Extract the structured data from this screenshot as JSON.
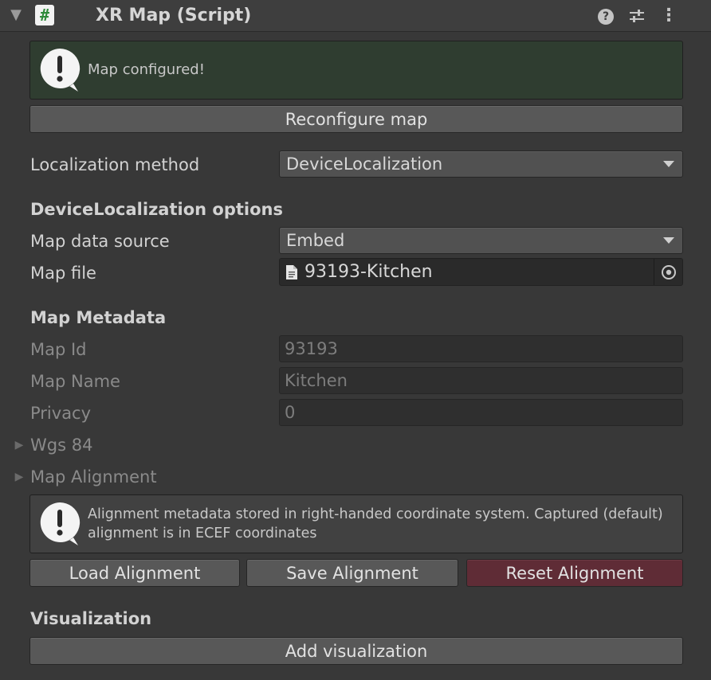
{
  "header": {
    "title": "XR Map (Script)",
    "icons": [
      "foldout-arrow-icon",
      "script-hash-icon",
      "help-icon",
      "preset-sliders-icon",
      "more-vertical-icon"
    ],
    "script_icon_glyph": "#"
  },
  "status_helpbox": {
    "message": "Map configured!",
    "icon": "info-balloon-icon",
    "color": "#2f3d30"
  },
  "reconfigure_button": {
    "label": "Reconfigure map"
  },
  "localization": {
    "label": "Localization method",
    "value": "DeviceLocalization"
  },
  "device_localization": {
    "title": "DeviceLocalization options",
    "data_source": {
      "label": "Map data source",
      "value": "Embed"
    },
    "map_file": {
      "label": "Map file",
      "value": "93193-Kitchen",
      "icon": "text-file-icon"
    }
  },
  "metadata": {
    "title": "Map Metadata",
    "map_id": {
      "label": "Map Id",
      "value": "93193"
    },
    "map_name": {
      "label": "Map Name",
      "value": "Kitchen"
    },
    "privacy": {
      "label": "Privacy",
      "value": "0"
    },
    "wgs84": {
      "label": "Wgs 84"
    },
    "alignment": {
      "label": "Map Alignment"
    }
  },
  "alignment_helpbox": {
    "message": "Alignment metadata stored in right-handed coordinate system. Captured (default) alignment is in ECEF coordinates",
    "icon": "info-balloon-icon"
  },
  "alignment_buttons": {
    "load": "Load Alignment",
    "save": "Save Alignment",
    "reset": "Reset Alignment",
    "reset_color": "#5f2c36"
  },
  "visualization": {
    "title": "Visualization",
    "add_button": "Add visualization"
  }
}
